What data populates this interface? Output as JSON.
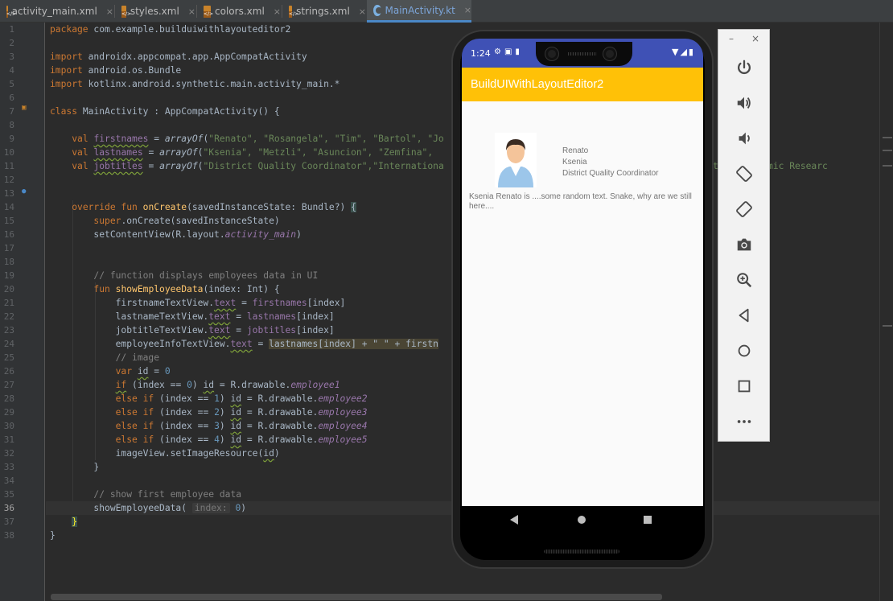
{
  "tabs": [
    {
      "label": "activity_main.xml",
      "icon": "xml-file-icon",
      "active": false
    },
    {
      "label": "styles.xml",
      "icon": "xml-file-icon",
      "active": false
    },
    {
      "label": "colors.xml",
      "icon": "xml-file-icon",
      "active": false
    },
    {
      "label": "strings.xml",
      "icon": "xml-file-icon",
      "active": false
    },
    {
      "label": "MainActivity.kt",
      "icon": "kotlin-file-icon",
      "active": true
    }
  ],
  "tab_close": "×",
  "line_numbers": [
    "1",
    "2",
    "3",
    "4",
    "5",
    "6",
    "7",
    "8",
    "9",
    "10",
    "11",
    "12",
    "13",
    "14",
    "15",
    "16",
    "17",
    "18",
    "19",
    "20",
    "21",
    "22",
    "23",
    "24",
    "25",
    "26",
    "27",
    "28",
    "29",
    "30",
    "31",
    "32",
    "33",
    "34",
    "35",
    "36",
    "37",
    "38"
  ],
  "current_line": "36",
  "code": {
    "l1": "package com.example.builduiwithlayouteditor2",
    "l3": "import androidx.appcompat.app.AppCompatActivity",
    "l4": "import android.os.Bundle",
    "l5": "import kotlinx.android.synthetic.main.activity_main.*",
    "l7_kw": "class ",
    "l7_rest": "MainActivity : AppCompatActivity() {",
    "l9_names": "\"Renato\", \"Rosangela\", \"Tim\", \"Bartol\", \"Jo",
    "l10_names": "\"Ksenia\", \"Metzli\", \"Asuncion\", \"Zemfina\", ",
    "l11_titles": "\"District Quality Coordinator\",\"Internationa",
    "l11_overflow": "tor\",\"Dynamic Researc",
    "l18": "// function displays employees data in UI",
    "l23_tail": "lastnames[index] + \" \" + firstn",
    "l24": "// image",
    "l34": "// show first employee data",
    "hint_index": "index:"
  },
  "phone": {
    "time": "1:24",
    "app_title": "BuildUIWithLayoutEditor2",
    "firstname": "Renato",
    "lastname": "Ksenia",
    "jobtitle": "District Quality Coordinator",
    "info": "Ksenia Renato is ....some random text. Snake, why are we still here...."
  },
  "panel": {
    "minimize": "–",
    "close": "×",
    "buttons": [
      "power-icon",
      "volume-up-icon",
      "volume-down-icon",
      "rotate-left-icon",
      "rotate-right-icon",
      "camera-icon",
      "zoom-icon",
      "back-icon",
      "home-icon",
      "overview-icon",
      "more-icon"
    ]
  },
  "colors": {
    "status_bar": "#3f51b5",
    "app_bar": "#ffc107",
    "active_tab": "#7ca5d9",
    "editor_bg": "#2b2b2b"
  }
}
